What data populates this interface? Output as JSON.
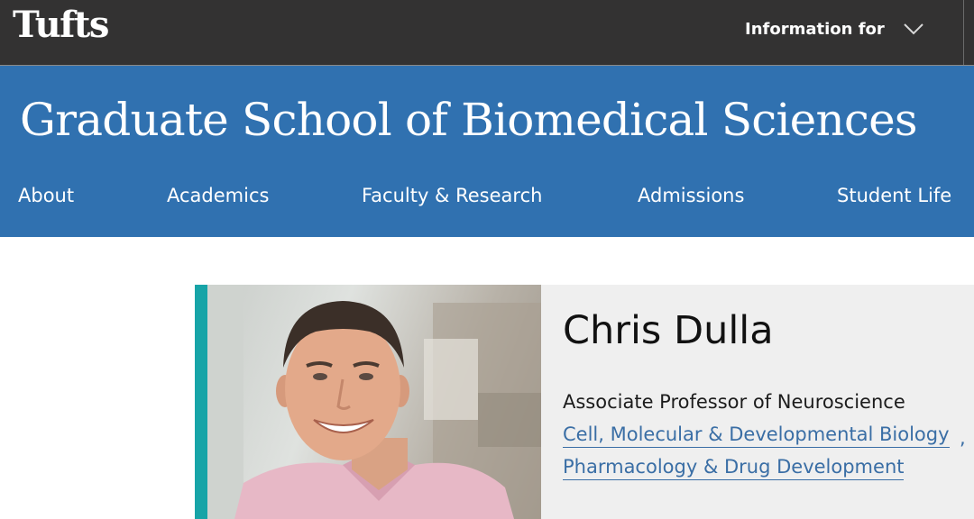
{
  "header": {
    "logo_text": "Tufts",
    "info_for_label": "Information for"
  },
  "banner": {
    "title": "Graduate School of Biomedical Sciences",
    "nav": [
      {
        "label": "About"
      },
      {
        "label": "Academics"
      },
      {
        "label": "Faculty & Research"
      },
      {
        "label": "Admissions"
      },
      {
        "label": "Student Life"
      }
    ]
  },
  "profile": {
    "name": "Chris Dulla",
    "title": "Associate Professor of Neuroscience",
    "programs": [
      "Cell, Molecular & Developmental Biology",
      "Pharmacology & Drug Development"
    ],
    "separator": ",",
    "accent_color": "#17a4a7"
  },
  "colors": {
    "topbar": "#333232",
    "banner": "#3071b0",
    "link": "#3a6ea5"
  },
  "icons": {
    "info_for_chevron": "chevron-down-icon"
  }
}
